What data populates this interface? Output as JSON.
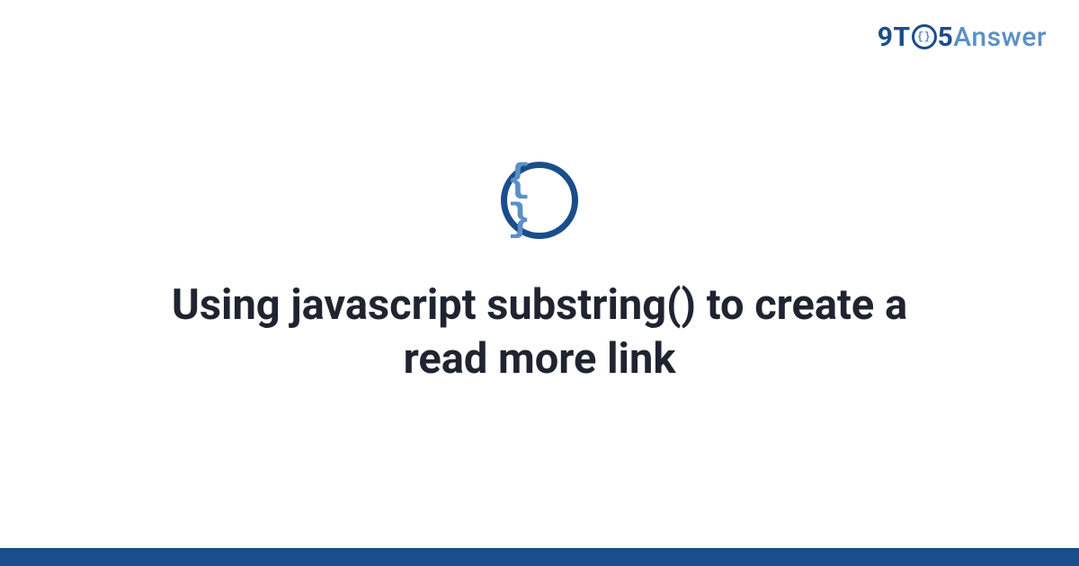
{
  "logo": {
    "part1": "9T",
    "circle_inner": "{}",
    "part2": "5",
    "part3": "Answer"
  },
  "icon": {
    "glyph": "{ }",
    "name": "code-braces-icon"
  },
  "title": "Using javascript substring() to create a read more link",
  "colors": {
    "primary": "#1a4d8c",
    "accent": "#5a8fc7",
    "text": "#1f2430"
  }
}
